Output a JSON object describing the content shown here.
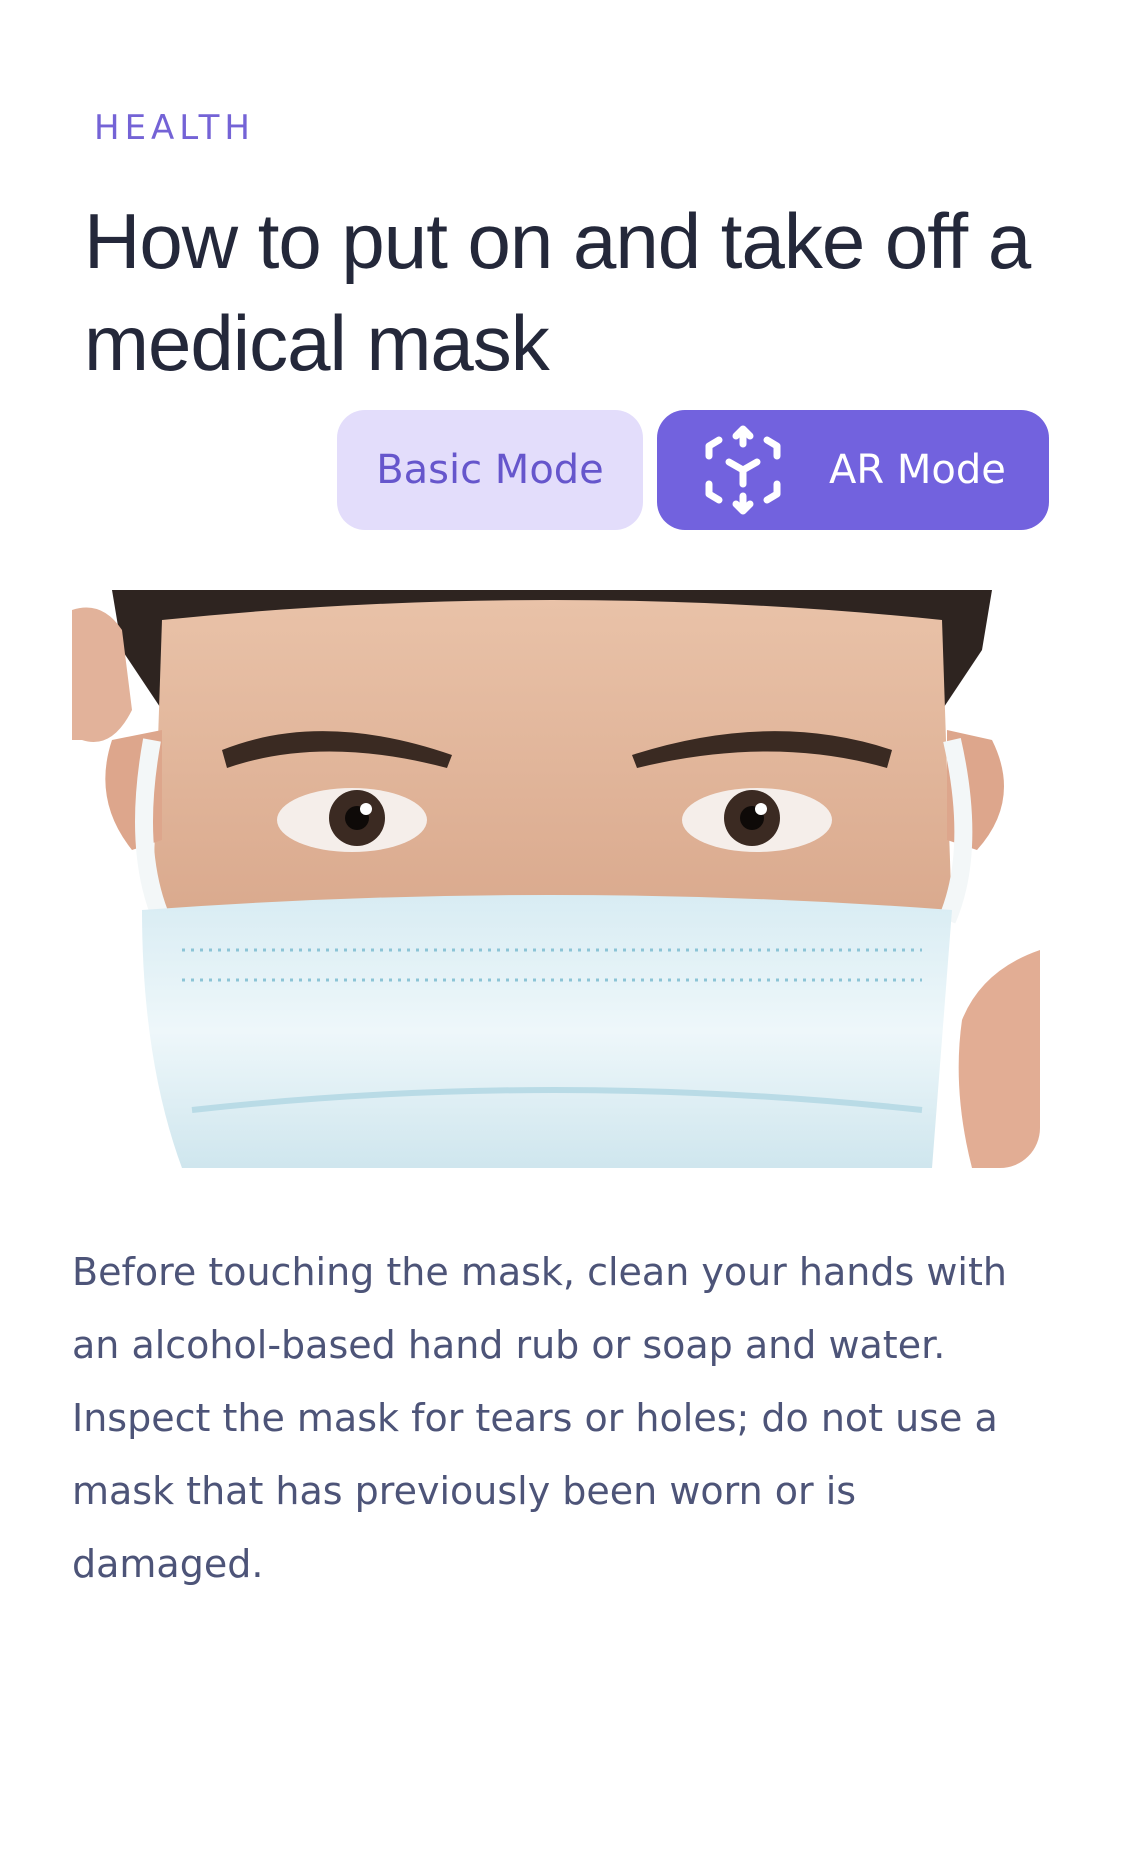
{
  "article": {
    "category": "HEALTH",
    "title": "How to put on and take off a medical mask",
    "paragraphs": [
      "Before touching the mask, clean your hands with an alcohol-based hand rub or soap and water.",
      "Inspect the mask for tears or holes; do not use a mask that has previously been worn or is damaged."
    ]
  },
  "modes": {
    "basic_label": "Basic Mode",
    "ar_label": "AR Mode",
    "ar_icon": "ar-cube-icon",
    "active": "AR Mode"
  },
  "hero_image": {
    "subject": "person-wearing-medical-mask"
  },
  "colors": {
    "accent": "#7262de",
    "accent_light": "#e3ddfb",
    "title": "#24283a",
    "body": "#4d5478"
  }
}
